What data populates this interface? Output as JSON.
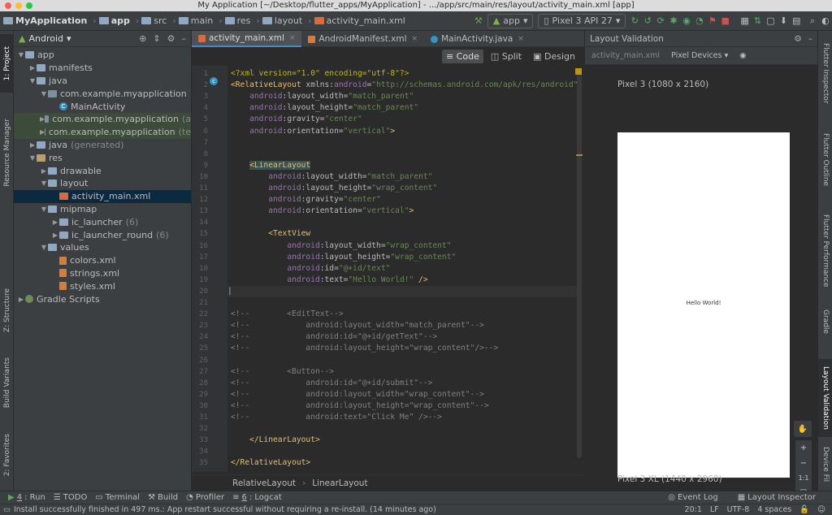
{
  "window": {
    "title": "My Application [~/Desktop/flutter_apps/MyApplication] - .../app/src/main/res/layout/activity_main.xml [app]"
  },
  "navbar": {
    "breadcrumbs": [
      "MyApplication",
      "app",
      "src",
      "main",
      "res",
      "layout",
      "activity_main.xml"
    ],
    "run_config": "app",
    "device": "Pixel 3 API 27"
  },
  "left_strip": {
    "tabs": [
      "1: Project",
      "Resource Manager",
      "Z: Structure",
      "Build Variants",
      "2: Favorites"
    ]
  },
  "project": {
    "view_mode": "Android",
    "tree": [
      {
        "label": "app",
        "depth": 0,
        "icon": "folder",
        "arrow": "down"
      },
      {
        "label": "manifests",
        "depth": 1,
        "icon": "folder",
        "arrow": "right"
      },
      {
        "label": "java",
        "depth": 1,
        "icon": "folder",
        "arrow": "down"
      },
      {
        "label": "com.example.myapplication",
        "depth": 2,
        "icon": "package",
        "arrow": "down"
      },
      {
        "label": "MainActivity",
        "depth": 3,
        "icon": "class",
        "arrow": ""
      },
      {
        "label": "com.example.myapplication",
        "suffix": "(a",
        "depth": 2,
        "icon": "package",
        "arrow": "right",
        "highlight": true
      },
      {
        "label": "com.example.myapplication",
        "suffix": "(te",
        "depth": 2,
        "icon": "package",
        "arrow": "right",
        "highlight": true
      },
      {
        "label": "java",
        "suffix": "(generated)",
        "depth": 1,
        "icon": "folder",
        "arrow": "right"
      },
      {
        "label": "res",
        "depth": 1,
        "icon": "res",
        "arrow": "down"
      },
      {
        "label": "drawable",
        "depth": 2,
        "icon": "folder",
        "arrow": "right"
      },
      {
        "label": "layout",
        "depth": 2,
        "icon": "folder",
        "arrow": "down"
      },
      {
        "label": "activity_main.xml",
        "depth": 3,
        "icon": "layout",
        "arrow": "",
        "selected": true
      },
      {
        "label": "mipmap",
        "depth": 2,
        "icon": "folder",
        "arrow": "down"
      },
      {
        "label": "ic_launcher",
        "suffix": "(6)",
        "depth": 3,
        "icon": "folder",
        "arrow": "right"
      },
      {
        "label": "ic_launcher_round",
        "suffix": "(6)",
        "depth": 3,
        "icon": "folder",
        "arrow": "right"
      },
      {
        "label": "values",
        "depth": 2,
        "icon": "folder",
        "arrow": "down"
      },
      {
        "label": "colors.xml",
        "depth": 3,
        "icon": "xml",
        "arrow": ""
      },
      {
        "label": "strings.xml",
        "depth": 3,
        "icon": "xml",
        "arrow": ""
      },
      {
        "label": "styles.xml",
        "depth": 3,
        "icon": "xml",
        "arrow": ""
      },
      {
        "label": "Gradle Scripts",
        "depth": 0,
        "icon": "gradle",
        "arrow": "right"
      }
    ]
  },
  "editor": {
    "tabs": [
      {
        "label": "activity_main.xml",
        "active": true
      },
      {
        "label": "AndroidManifest.xml",
        "active": false
      },
      {
        "label": "MainActivity.java",
        "active": false
      }
    ],
    "modes": [
      "Code",
      "Split",
      "Design"
    ],
    "active_mode": "Code",
    "cursor_line": 20,
    "lines": [
      {
        "n": 1,
        "segs": [
          [
            "pi",
            "<?xml version=\"1.0\" encoding=\"utf-8\"?>"
          ]
        ]
      },
      {
        "n": 2,
        "segs": [
          [
            "tg",
            "<RelativeLayout "
          ],
          [
            "at",
            "xmlns:"
          ],
          [
            "atn",
            "android"
          ],
          [
            "at",
            "="
          ],
          [
            "val",
            "\"http://schemas.android.com/apk/res/android\""
          ]
        ]
      },
      {
        "n": 3,
        "segs": [
          [
            "",
            "    "
          ],
          [
            "atn",
            "android"
          ],
          [
            "at",
            ":layout_width="
          ],
          [
            "val",
            "\"match_parent\""
          ]
        ]
      },
      {
        "n": 4,
        "segs": [
          [
            "",
            "    "
          ],
          [
            "atn",
            "android"
          ],
          [
            "at",
            ":layout_height="
          ],
          [
            "val",
            "\"match_parent\""
          ]
        ]
      },
      {
        "n": 5,
        "segs": [
          [
            "",
            "    "
          ],
          [
            "atn",
            "android"
          ],
          [
            "at",
            ":gravity="
          ],
          [
            "val",
            "\"center\""
          ]
        ]
      },
      {
        "n": 6,
        "segs": [
          [
            "",
            "    "
          ],
          [
            "atn",
            "android"
          ],
          [
            "at",
            ":orientation="
          ],
          [
            "val",
            "\"vertical\""
          ],
          [
            "tg",
            ">"
          ]
        ]
      },
      {
        "n": 7,
        "segs": []
      },
      {
        "n": 8,
        "segs": []
      },
      {
        "n": 9,
        "segs": [
          [
            "",
            "    "
          ],
          [
            "tg match",
            "<LinearLayout"
          ]
        ]
      },
      {
        "n": 10,
        "segs": [
          [
            "",
            "        "
          ],
          [
            "atn",
            "android"
          ],
          [
            "at",
            ":layout_width="
          ],
          [
            "val",
            "\"match_parent\""
          ]
        ]
      },
      {
        "n": 11,
        "segs": [
          [
            "",
            "        "
          ],
          [
            "atn",
            "android"
          ],
          [
            "at",
            ":layout_height="
          ],
          [
            "val",
            "\"wrap_content\""
          ]
        ]
      },
      {
        "n": 12,
        "segs": [
          [
            "",
            "        "
          ],
          [
            "atn",
            "android"
          ],
          [
            "at",
            ":gravity="
          ],
          [
            "val",
            "\"center\""
          ]
        ]
      },
      {
        "n": 13,
        "segs": [
          [
            "",
            "        "
          ],
          [
            "atn",
            "android"
          ],
          [
            "at",
            ":orientation="
          ],
          [
            "val",
            "\"vertical\""
          ],
          [
            "tg",
            ">"
          ]
        ]
      },
      {
        "n": 14,
        "segs": []
      },
      {
        "n": 15,
        "segs": [
          [
            "",
            "        "
          ],
          [
            "tg",
            "<TextView"
          ]
        ]
      },
      {
        "n": 16,
        "segs": [
          [
            "",
            "            "
          ],
          [
            "atn",
            "android"
          ],
          [
            "at",
            ":layout_width="
          ],
          [
            "val",
            "\"wrap_content\""
          ]
        ]
      },
      {
        "n": 17,
        "segs": [
          [
            "",
            "            "
          ],
          [
            "atn",
            "android"
          ],
          [
            "at",
            ":layout_height="
          ],
          [
            "val",
            "\"wrap_content\""
          ]
        ]
      },
      {
        "n": 18,
        "segs": [
          [
            "",
            "            "
          ],
          [
            "atn",
            "android"
          ],
          [
            "at",
            ":id="
          ],
          [
            "val",
            "\"@+id/text\""
          ]
        ]
      },
      {
        "n": 19,
        "segs": [
          [
            "",
            "            "
          ],
          [
            "atn",
            "android"
          ],
          [
            "at",
            ":text="
          ],
          [
            "val",
            "\"Hello World!\""
          ],
          [
            "tg",
            " />"
          ]
        ]
      },
      {
        "n": 20,
        "segs": [
          [
            "",
            "|"
          ]
        ]
      },
      {
        "n": 21,
        "segs": []
      },
      {
        "n": 22,
        "segs": [
          [
            "cm",
            "<!--        <EditText-->"
          ]
        ]
      },
      {
        "n": 23,
        "segs": [
          [
            "cm",
            "<!--            android:layout_width=\"match_parent\"-->"
          ]
        ]
      },
      {
        "n": 24,
        "segs": [
          [
            "cm",
            "<!--            android:id=\"@+id/getText\"-->"
          ]
        ]
      },
      {
        "n": 25,
        "segs": [
          [
            "cm",
            "<!--            android:layout_height=\"wrap_content\"/>-->"
          ]
        ]
      },
      {
        "n": 26,
        "segs": []
      },
      {
        "n": 27,
        "segs": [
          [
            "cm",
            "<!--        <Button-->"
          ]
        ]
      },
      {
        "n": 28,
        "segs": [
          [
            "cm",
            "<!--            android:id=\"@+id/submit\"-->"
          ]
        ]
      },
      {
        "n": 29,
        "segs": [
          [
            "cm",
            "<!--            android:layout_width=\"wrap_content\"-->"
          ]
        ]
      },
      {
        "n": 30,
        "segs": [
          [
            "cm",
            "<!--            android:layout_height=\"wrap_content\"-->"
          ]
        ]
      },
      {
        "n": 31,
        "segs": [
          [
            "cm",
            "<!--            android:text=\"Click Me\" />-->"
          ]
        ]
      },
      {
        "n": 32,
        "segs": []
      },
      {
        "n": 33,
        "segs": [
          [
            "",
            "    "
          ],
          [
            "tg",
            "</LinearLayout>"
          ]
        ]
      },
      {
        "n": 34,
        "segs": []
      },
      {
        "n": 35,
        "segs": [
          [
            "tg",
            "</RelativeLayout>"
          ]
        ]
      }
    ],
    "breadcrumb": [
      "RelativeLayout",
      "LinearLayout"
    ]
  },
  "layout_validation": {
    "title": "Layout Validation",
    "file_label": "activity_main.xml",
    "devices_label": "Pixel Devices",
    "device1": "Pixel 3 (1080 x 2160)",
    "device2": "Pixel 3 XL (1440 x 2960)",
    "preview_text": "Hello World!",
    "zoom_ratio": "1:1"
  },
  "right_strip": {
    "tabs": [
      "Flutter Inspector",
      "Flutter Outline",
      "Flutter Performance",
      "Gradle",
      "Layout Validation",
      "Device Fil"
    ]
  },
  "tool_windows": {
    "left": [
      {
        "key": "4",
        "label": ": Run"
      },
      {
        "key": "",
        "label": "TODO"
      },
      {
        "key": "",
        "label": "Terminal"
      },
      {
        "key": "",
        "label": "Build"
      },
      {
        "key": "",
        "label": "Profiler"
      },
      {
        "key": "6",
        "label": ": Logcat"
      }
    ],
    "right": [
      "Event Log",
      "Layout Inspector"
    ]
  },
  "status": {
    "message": "Install successfully finished in 497 ms.: App restart successful without requiring a re-install. (14 minutes ago)",
    "position": "20:1",
    "line_sep": "LF",
    "encoding": "UTF-8",
    "indent": "4 spaces"
  }
}
